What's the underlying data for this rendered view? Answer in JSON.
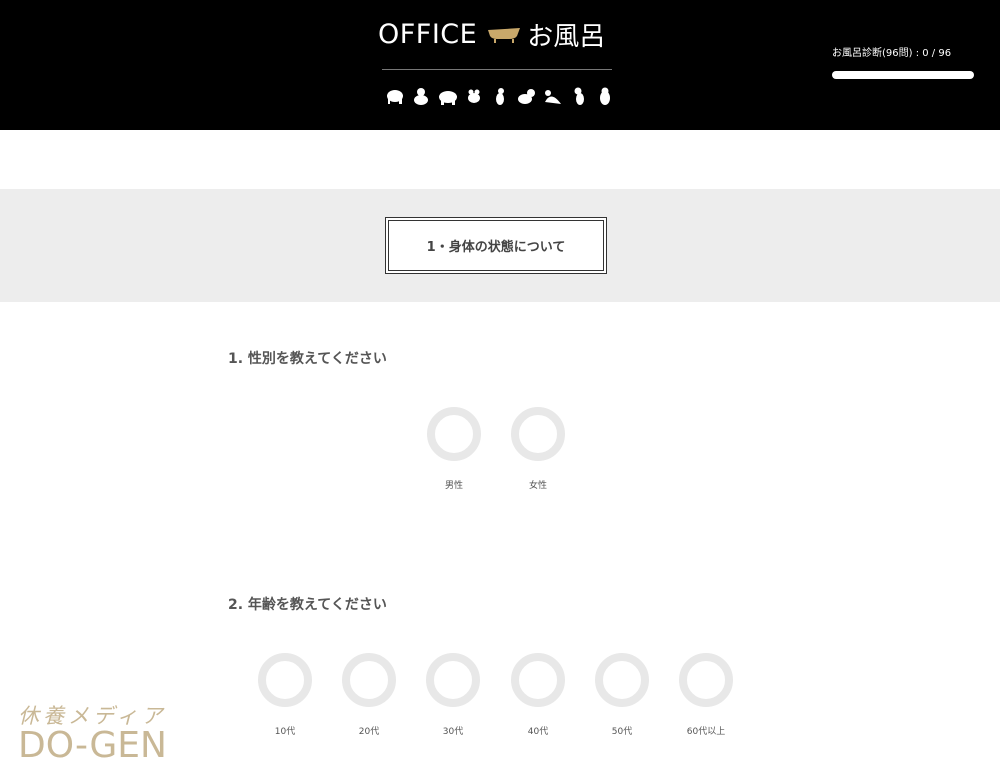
{
  "header": {
    "logo_office": "OFFICE",
    "logo_ofuro": "お風呂",
    "animals": [
      "elephant-icon",
      "gorilla-icon",
      "bear-icon",
      "frog-icon",
      "bird-icon",
      "cat-icon",
      "sea-lion-icon",
      "parrot-icon",
      "penguin-icon"
    ],
    "progress_label": "お風呂診断(96問) : 0 / 96",
    "progress_fraction": 0,
    "colors": {
      "background": "#000000",
      "text": "#ffffff",
      "accent": "#c9a86a"
    }
  },
  "section": {
    "title": "1・身体の状態について"
  },
  "questions": [
    {
      "title": "1. 性別を教えてください",
      "options": [
        "男性",
        "女性"
      ]
    },
    {
      "title": "2. 年齢を教えてください",
      "options": [
        "10代",
        "20代",
        "30代",
        "40代",
        "50代",
        "60代以上"
      ]
    }
  ],
  "watermark": {
    "jp": "休養メディア",
    "en": "DO-GEN"
  }
}
